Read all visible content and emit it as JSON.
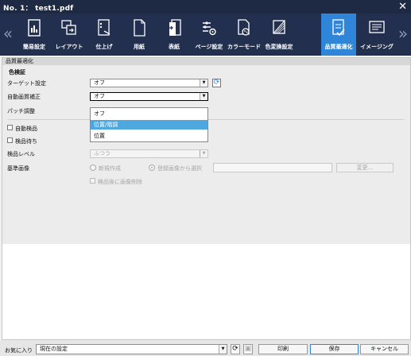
{
  "window": {
    "title": "No. 1： test1.pdf",
    "close_glyph": "✕"
  },
  "toolbar": {
    "prev_glyph": "«",
    "next_glyph": "»",
    "tabs": [
      {
        "label": "簡易設定",
        "icon": "simple-settings-icon"
      },
      {
        "label": "レイアウト",
        "icon": "layout-icon"
      },
      {
        "label": "仕上げ",
        "icon": "finishing-icon"
      },
      {
        "label": "用紙",
        "icon": "paper-icon"
      },
      {
        "label": "表紙",
        "icon": "cover-icon"
      },
      {
        "label": "ページ設定",
        "icon": "page-settings-icon"
      },
      {
        "label": "カラーモード",
        "icon": "color-mode-icon"
      },
      {
        "label": "色変換設定",
        "icon": "color-conversion-icon"
      },
      {
        "label": "品質最適化",
        "icon": "quality-optimization-icon",
        "active": true
      },
      {
        "label": "イメージング",
        "icon": "imaging-icon"
      }
    ]
  },
  "section": {
    "header": "品質最適化",
    "group_title": "色検証",
    "target_label": "ターゲット設定",
    "target_value": "オフ",
    "auto_label": "自動画質補正",
    "auto_value": "オフ",
    "patch_label": "パッチ調整",
    "dropdown_options": [
      "オフ",
      "位置/階調",
      "位置"
    ],
    "highlighted_option": 1,
    "auto_inspect_label": "自動検品",
    "inspect_hold_label": "検品待ち",
    "inspect_level_label": "検品レベル",
    "inspect_level_value": "ふつう",
    "ref_image_label": "基準画像",
    "radio_new": "新規作成",
    "radio_registered": "登録画像から選択",
    "change_button": "変更...",
    "delete_after_label": "検品後に画像削除"
  },
  "footer": {
    "favorites_label": "お気に入り",
    "favorites_value": "現在の設定",
    "print_button": "印刷",
    "save_button": "保存",
    "cancel_button": "キャンセル"
  },
  "colors": {
    "titlebar": "#1e2a44",
    "toolbar": "#232f4e",
    "active_tab": "#2f86d8",
    "highlight": "#4ea7de"
  }
}
